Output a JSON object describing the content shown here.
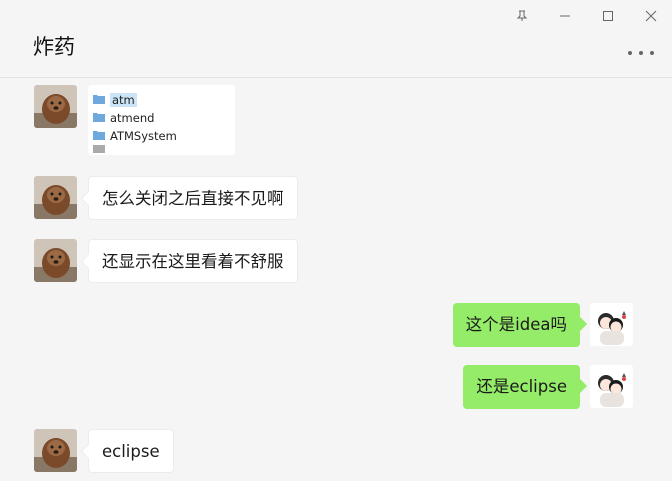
{
  "window": {
    "controls": [
      "pin-icon",
      "minimize-icon",
      "maximize-icon",
      "close-icon"
    ]
  },
  "header": {
    "title": "炸药"
  },
  "messages": [
    {
      "side": "in",
      "type": "image",
      "folders": [
        "atm",
        "atmend",
        "ATMSystem"
      ]
    },
    {
      "side": "in",
      "text": "怎么关闭之后直接不见啊"
    },
    {
      "side": "in",
      "text": "还显示在这里看着不舒服"
    },
    {
      "side": "out",
      "text": "这个是idea吗"
    },
    {
      "side": "out",
      "text": "还是eclipse"
    },
    {
      "side": "in",
      "text": "eclipse"
    }
  ],
  "colors": {
    "outgoing_bubble": "#95ec69",
    "incoming_bubble": "#ffffff",
    "background": "#f5f5f5"
  }
}
